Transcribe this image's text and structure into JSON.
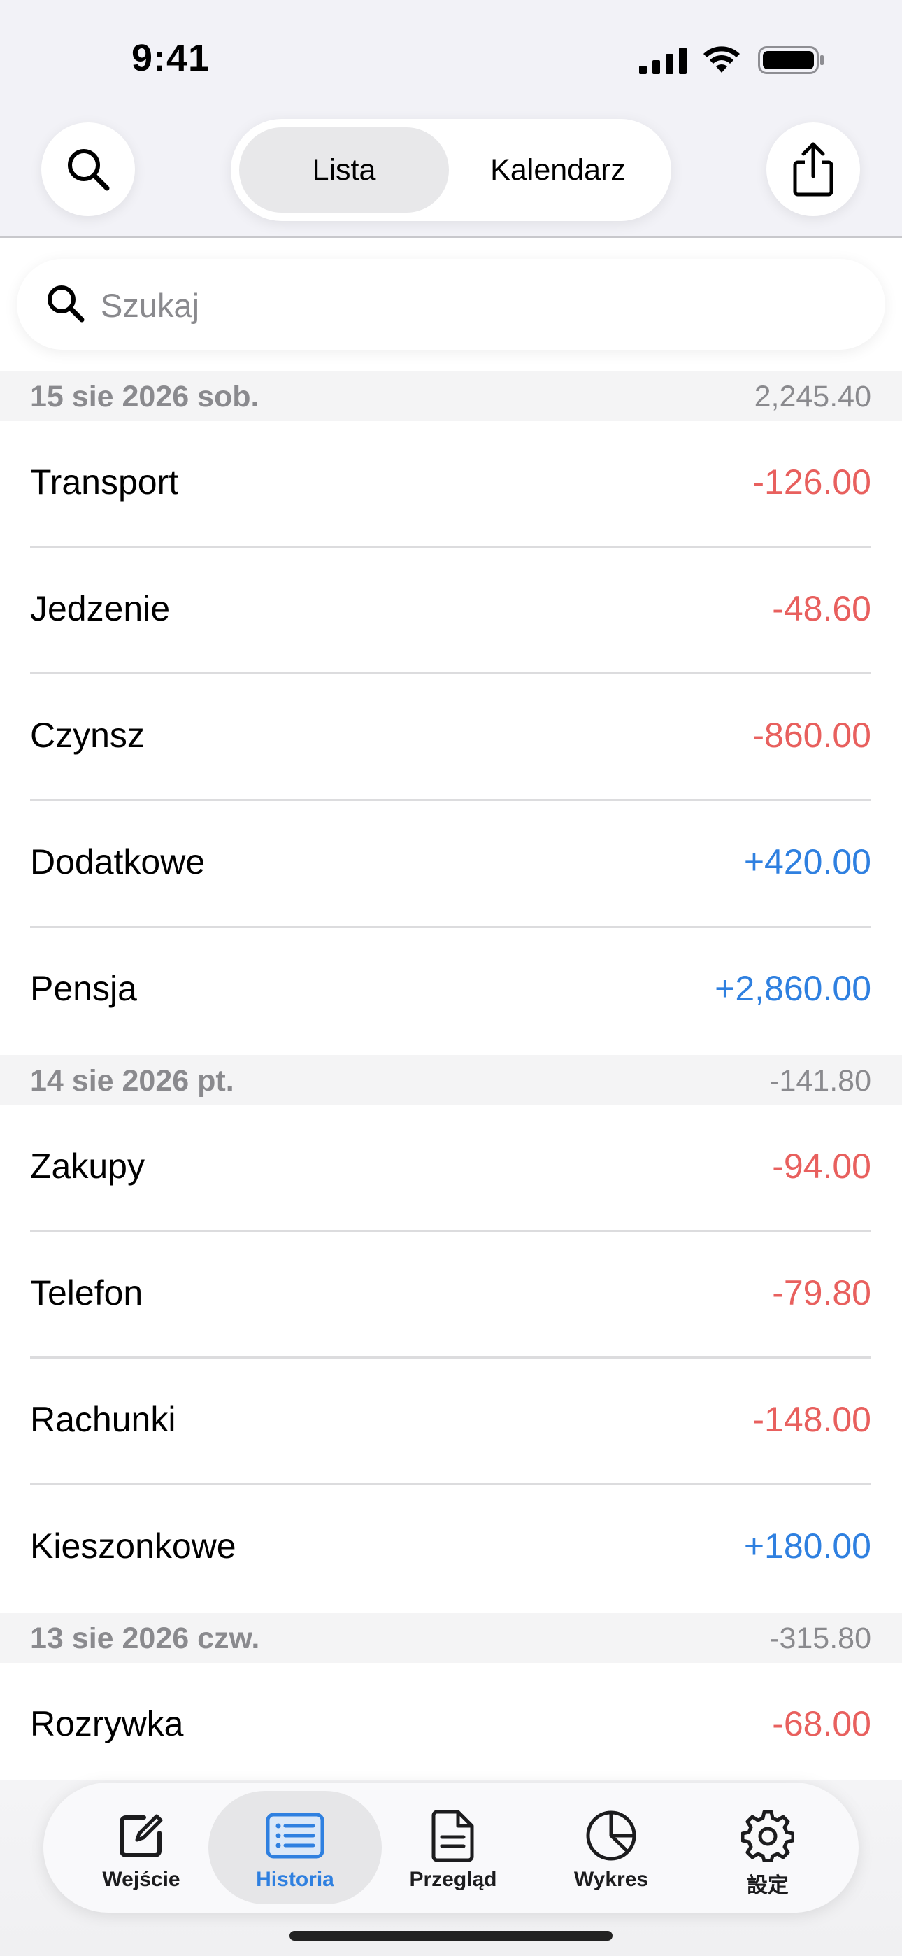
{
  "status_bar": {
    "time": "9:41"
  },
  "header": {
    "segments": [
      {
        "label": "Lista",
        "active": true
      },
      {
        "label": "Kalendarz",
        "active": false
      }
    ],
    "search_button_icon": "search-icon",
    "share_button_icon": "share-icon"
  },
  "search": {
    "placeholder": "Szukaj",
    "value": ""
  },
  "sections": [
    {
      "date": "15 sie 2026 sob.",
      "total": "2,245.40",
      "rows": [
        {
          "label": "Transport",
          "amount": "-126.00",
          "type": "neg"
        },
        {
          "label": "Jedzenie",
          "amount": "-48.60",
          "type": "neg"
        },
        {
          "label": "Czynsz",
          "amount": "-860.00",
          "type": "neg"
        },
        {
          "label": "Dodatkowe",
          "amount": "+420.00",
          "type": "pos"
        },
        {
          "label": "Pensja",
          "amount": "+2,860.00",
          "type": "pos"
        }
      ]
    },
    {
      "date": "14 sie 2026 pt.",
      "total": "-141.80",
      "rows": [
        {
          "label": "Zakupy",
          "amount": "-94.00",
          "type": "neg"
        },
        {
          "label": "Telefon",
          "amount": "-79.80",
          "type": "neg"
        },
        {
          "label": "Rachunki",
          "amount": "-148.00",
          "type": "neg"
        },
        {
          "label": "Kieszonkowe",
          "amount": "+180.00",
          "type": "pos"
        }
      ]
    },
    {
      "date": "13 sie 2026 czw.",
      "total": "-315.80",
      "rows": [
        {
          "label": "Rozrywka",
          "amount": "-68.00",
          "type": "neg"
        }
      ]
    }
  ],
  "tabbar": {
    "tabs": [
      {
        "label": "Wejście",
        "icon": "compose-icon",
        "active": false
      },
      {
        "label": "Historia",
        "icon": "list-icon",
        "active": true
      },
      {
        "label": "Przegląd",
        "icon": "document-icon",
        "active": false
      },
      {
        "label": "Wykres",
        "icon": "pie-chart-icon",
        "active": false
      },
      {
        "label": "設定",
        "icon": "gear-icon",
        "active": false
      }
    ]
  },
  "colors": {
    "negative": "#e8605e",
    "positive": "#2f80e0",
    "accent": "#2f80e0"
  }
}
